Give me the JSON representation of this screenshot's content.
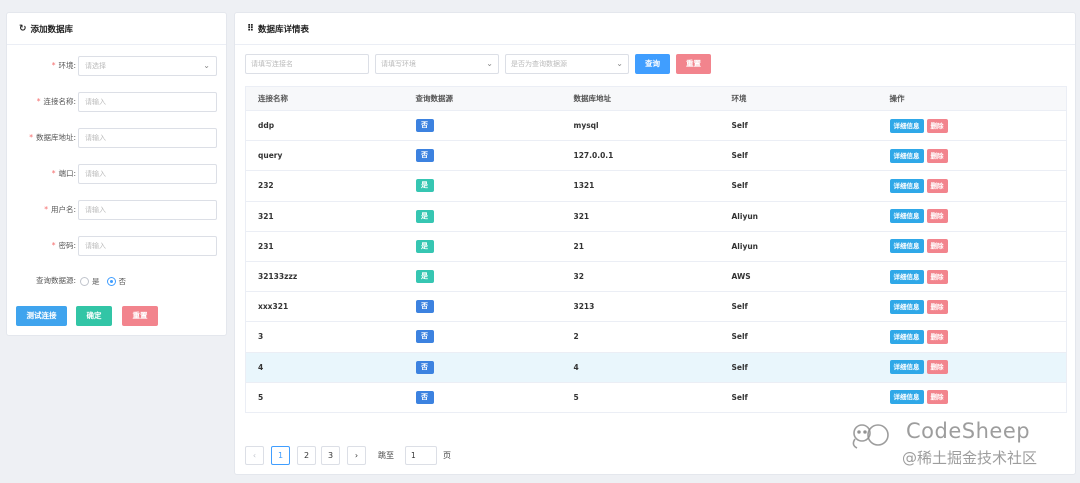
{
  "left_form": {
    "title": "添加数据库",
    "fields": [
      {
        "label": "环境:",
        "placeholder": "请选择",
        "required": true,
        "type": "select"
      },
      {
        "label": "连接名称:",
        "placeholder": "请输入",
        "required": true,
        "type": "text"
      },
      {
        "label": "数据库地址:",
        "placeholder": "请输入",
        "required": true,
        "type": "text"
      },
      {
        "label": "端口:",
        "placeholder": "请输入",
        "required": true,
        "type": "text"
      },
      {
        "label": "用户名:",
        "placeholder": "请输入",
        "required": true,
        "type": "text"
      },
      {
        "label": "密码:",
        "placeholder": "请输入",
        "required": true,
        "type": "text"
      }
    ],
    "query_source": {
      "label": "查询数据源:",
      "options": [
        "是",
        "否"
      ],
      "selected": "否"
    },
    "buttons": {
      "test": "测试连接",
      "confirm": "确定",
      "reset": "重置"
    }
  },
  "right_panel": {
    "title": "数据库详情表",
    "filters": {
      "name_placeholder": "请填写连接名",
      "env_placeholder": "请填写环境",
      "source_placeholder": "是否为查询数据源",
      "query_button": "查询",
      "reset_button": "重置"
    },
    "table": {
      "columns": [
        "连接名称",
        "查询数据源",
        "数据库地址",
        "环境",
        "操作"
      ],
      "rows": [
        {
          "name": "ddp",
          "source": "否",
          "address": "mysql",
          "env": "Self"
        },
        {
          "name": "query",
          "source": "否",
          "address": "127.0.0.1",
          "env": "Self"
        },
        {
          "name": "232",
          "source": "是",
          "address": "1321",
          "env": "Self"
        },
        {
          "name": "321",
          "source": "是",
          "address": "321",
          "env": "Aliyun"
        },
        {
          "name": "231",
          "source": "是",
          "address": "21",
          "env": "Aliyun"
        },
        {
          "name": "32133zzz",
          "source": "是",
          "address": "32",
          "env": "AWS"
        },
        {
          "name": "xxx321",
          "source": "否",
          "address": "3213",
          "env": "Self"
        },
        {
          "name": "3",
          "source": "否",
          "address": "2",
          "env": "Self"
        },
        {
          "name": "4",
          "source": "否",
          "address": "4",
          "env": "Self",
          "highlighted": true
        },
        {
          "name": "5",
          "source": "否",
          "address": "5",
          "env": "Self"
        }
      ],
      "detail_label": "详细信息",
      "delete_label": "删除"
    },
    "pagination": {
      "prev": "‹",
      "next": "›",
      "pages": [
        "1",
        "2",
        "3"
      ],
      "current": "1",
      "jump_label": "跳至",
      "jump_value": "1",
      "page_suffix": "页"
    }
  },
  "watermark": {
    "title": "CodeSheep",
    "subtitle": "@稀土掘金技术社区"
  },
  "colors": {
    "primary": "#409eff",
    "tag_no": "#3c82e0",
    "tag_yes": "#36c6b2",
    "danger": "#f2848d",
    "success": "#32c5a6"
  }
}
